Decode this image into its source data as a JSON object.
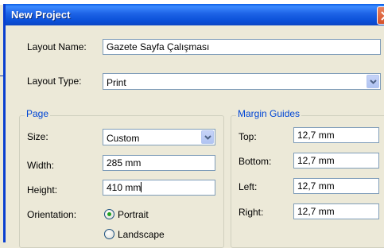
{
  "window": {
    "title": "New Project"
  },
  "layout_name": {
    "label": "Layout Name:",
    "value": "Gazete Sayfa Çalışması"
  },
  "layout_type": {
    "label": "Layout Type:",
    "value": "Print"
  },
  "page": {
    "title": "Page",
    "size": {
      "label": "Size:",
      "value": "Custom"
    },
    "width": {
      "label": "Width:",
      "value": "285 mm"
    },
    "height": {
      "label": "Height:",
      "value": "410 mm"
    },
    "orientation": {
      "label": "Orientation:",
      "options": [
        "Portrait",
        "Landscape"
      ],
      "selected": "Portrait"
    }
  },
  "margin_guides": {
    "title": "Margin Guides",
    "top": {
      "label": "Top:",
      "value": "12,7 mm"
    },
    "bottom": {
      "label": "Bottom:",
      "value": "12,7 mm"
    },
    "left": {
      "label": "Left:",
      "value": "12,7 mm"
    },
    "right": {
      "label": "Right:",
      "value": "12,7 mm"
    }
  },
  "colors": {
    "title_bar": "#0a4fd8",
    "group_title": "#0046d5",
    "dialog_bg": "#ece9d8",
    "field_border": "#7f9db9"
  }
}
